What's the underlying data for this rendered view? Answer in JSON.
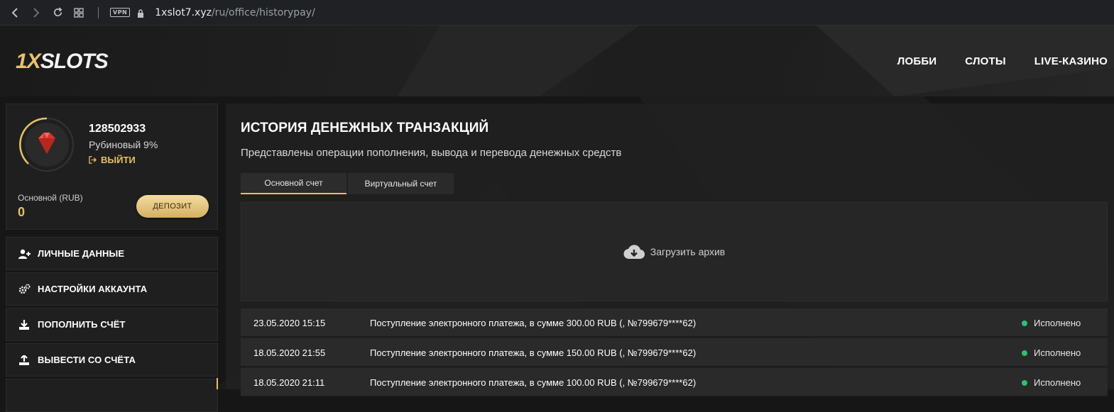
{
  "browser": {
    "vpn_label": "VPN",
    "url_host": "1xslot7.xyz",
    "url_path": "/ru/office/historypay/"
  },
  "header": {
    "logo_one": "1X",
    "logo_rest": "SLOTS",
    "nav": [
      "ЛОББИ",
      "СЛОТЫ",
      "LIVE-КАЗИНО"
    ]
  },
  "profile": {
    "user_id": "128502933",
    "level": "Рубиновый 9%",
    "logout_label": "ВЫЙТИ",
    "balance_label": "Основной (RUB)",
    "balance_value": "0",
    "deposit_label": "ДЕПОЗИТ"
  },
  "sidebar": {
    "items": [
      {
        "label": "ЛИЧНЫЕ ДАННЫЕ",
        "icon": "user-plus-icon"
      },
      {
        "label": "НАСТРОЙКИ АККАУНТА",
        "icon": "gears-icon"
      },
      {
        "label": "ПОПОЛНИТЬ СЧЁТ",
        "icon": "download-icon"
      },
      {
        "label": "ВЫВЕСТИ СО СЧЁТА",
        "icon": "upload-icon"
      }
    ]
  },
  "main": {
    "title": "ИСТОРИЯ ДЕНЕЖНЫХ ТРАНЗАКЦИЙ",
    "subtitle": "Представлены операции пополнения, вывода и перевода денежных средств",
    "tabs": [
      "Основной счет",
      "Виртуальный счет"
    ],
    "archive_label": "Загрузить архив",
    "transactions": [
      {
        "date": "23.05.2020 15:15",
        "description": "Поступление электронного платежа, в сумме 300.00 RUB (, №799679****62)",
        "status": "Исполнено"
      },
      {
        "date": "18.05.2020 21:55",
        "description": "Поступление электронного платежа, в сумме 150.00 RUB (, №799679****62)",
        "status": "Исполнено"
      },
      {
        "date": "18.05.2020 21:11",
        "description": "Поступление электронного платежа, в сумме 100.00 RUB (, №799679****62)",
        "status": "Исполнено"
      }
    ]
  },
  "colors": {
    "accent_gold": "#e6c065",
    "status_green": "#2fbf71",
    "background": "#161616"
  }
}
